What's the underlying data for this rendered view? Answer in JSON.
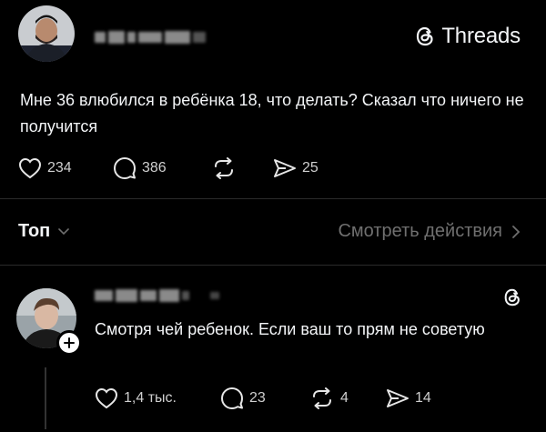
{
  "post": {
    "author_name": "",
    "brand": "Threads",
    "text": "Мне 36 влюбился в ребёнка 18, что делать? Сказал что ничего не получится",
    "likes": "234",
    "comments": "386",
    "shares": "25"
  },
  "sort": {
    "label": "Топ",
    "activity_link": "Смотреть действия"
  },
  "reply": {
    "author_name": "",
    "text": "Смотря чей ребенок. Если ваш то прям не советую",
    "likes": "1,4 тыс.",
    "comments": "23",
    "reposts": "4",
    "shares": "14"
  },
  "colors": {
    "background": "#000000",
    "text": "#f3f5f7",
    "muted": "#6f6f6f",
    "divider": "#2a2a2a"
  }
}
